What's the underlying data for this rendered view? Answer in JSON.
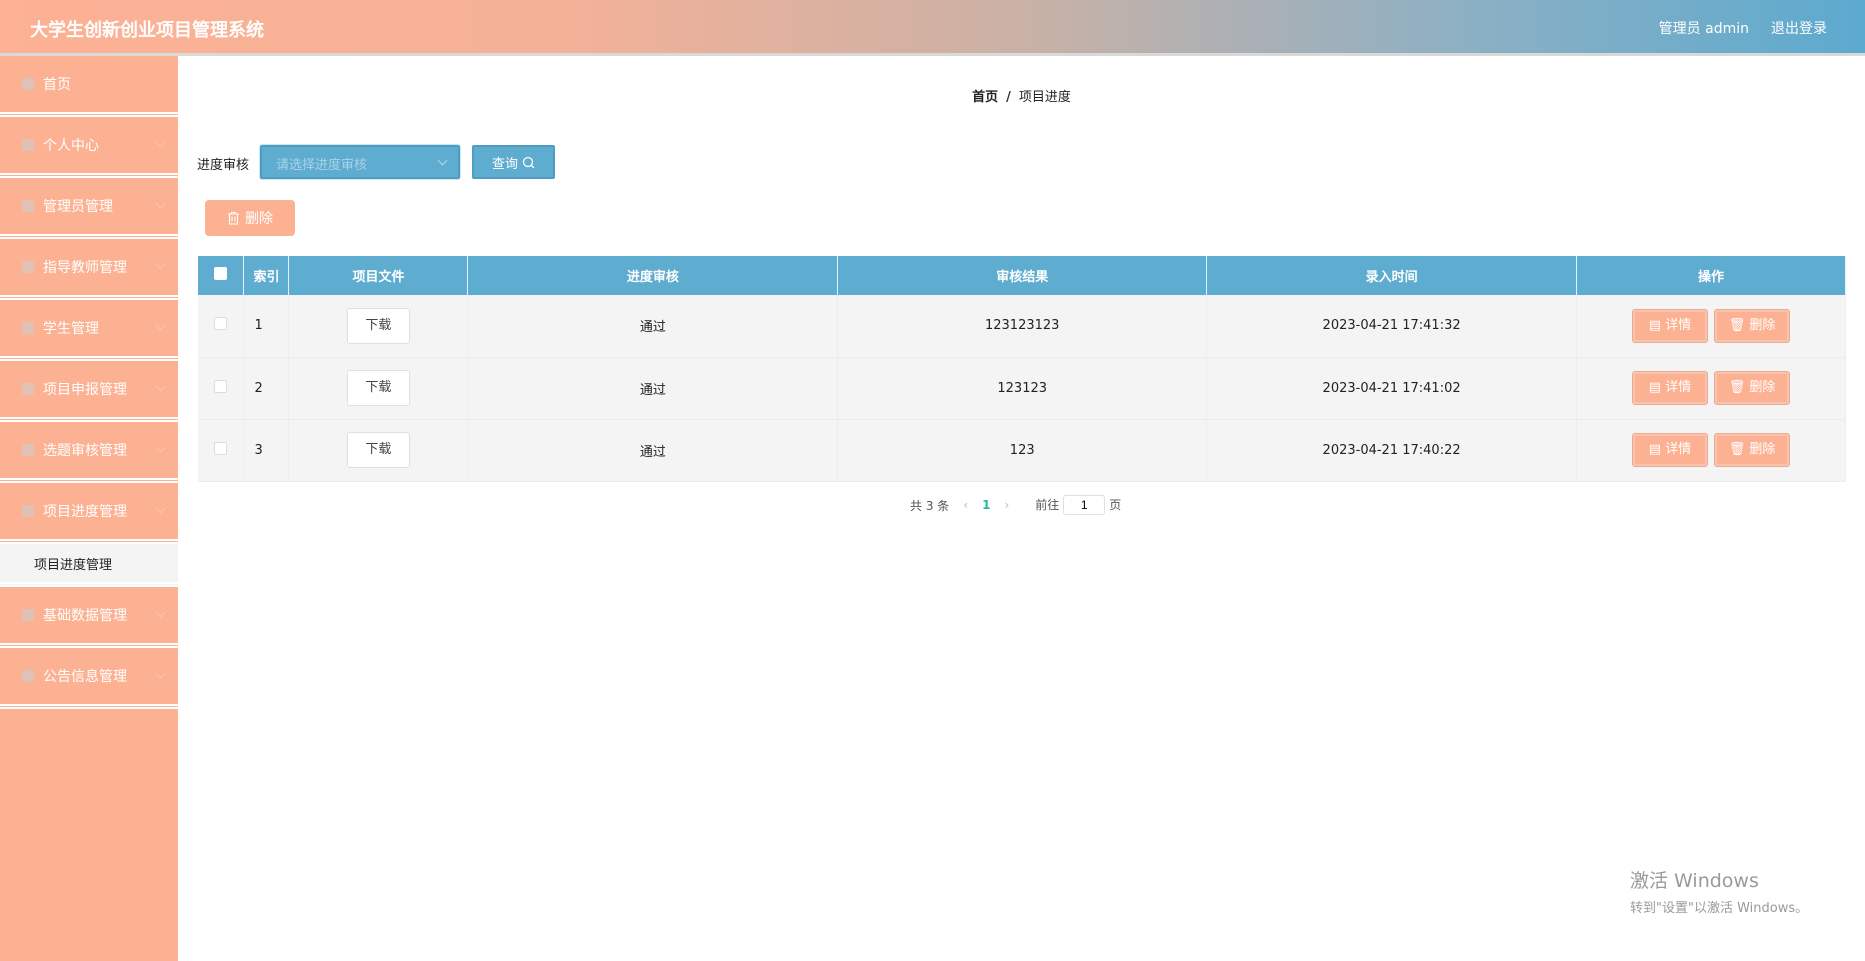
{
  "header": {
    "title": "大学生创新创业项目管理系统",
    "user": "管理员 admin",
    "logout": "退出登录"
  },
  "sidebar": {
    "items": [
      {
        "label": "首页",
        "icon": "home-icon"
      },
      {
        "label": "个人中心",
        "icon": "user-icon"
      },
      {
        "label": "管理员管理",
        "icon": "admin-icon"
      },
      {
        "label": "指导教师管理",
        "icon": "teacher-icon"
      },
      {
        "label": "学生管理",
        "icon": "grid-icon"
      },
      {
        "label": "项目申报管理",
        "icon": "pin-icon"
      },
      {
        "label": "选题审核管理",
        "icon": "grid-icon"
      },
      {
        "label": "项目进度管理",
        "icon": "grid-icon"
      }
    ],
    "sub_item": "项目进度管理",
    "items_after": [
      {
        "label": "基础数据管理",
        "icon": "grid-icon"
      },
      {
        "label": "公告信息管理",
        "icon": "grid-icon"
      }
    ]
  },
  "breadcrumb": {
    "home": "首页",
    "sep": "/",
    "current": "项目进度"
  },
  "filter": {
    "label": "进度审核",
    "placeholder": "请选择进度审核",
    "query": "查询"
  },
  "toolbar": {
    "delete": "删除"
  },
  "table": {
    "headers": [
      "索引",
      "项目文件",
      "进度审核",
      "审核结果",
      "录入时间",
      "操作"
    ],
    "rows": [
      {
        "index": "1",
        "file": "下载",
        "status": "通过",
        "result": "123123123",
        "time": "2023-04-21 17:41:32"
      },
      {
        "index": "2",
        "file": "下载",
        "status": "通过",
        "result": "123123",
        "time": "2023-04-21 17:41:02"
      },
      {
        "index": "3",
        "file": "下载",
        "status": "通过",
        "result": "123",
        "time": "2023-04-21 17:40:22"
      }
    ],
    "detail": "详情",
    "delete": "删除"
  },
  "pagination": {
    "total": "共 3 条",
    "current": "1",
    "goto": "前往",
    "page_value": "1",
    "page_suffix": "页"
  },
  "watermark": {
    "line1": "激活 Windows",
    "line2": "转到\"设置\"以激活 Windows。"
  }
}
